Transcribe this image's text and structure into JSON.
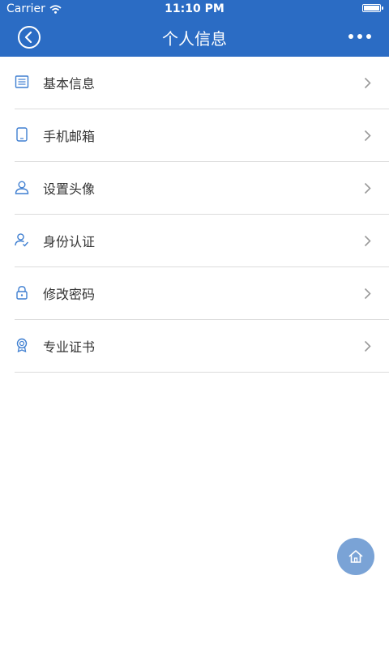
{
  "status_bar": {
    "carrier": "Carrier",
    "time": "11:10 PM"
  },
  "header": {
    "title": "个人信息"
  },
  "menu": {
    "items": [
      {
        "label": "基本信息",
        "icon": "document-list-icon"
      },
      {
        "label": "手机邮箱",
        "icon": "tablet-icon"
      },
      {
        "label": "设置头像",
        "icon": "user-icon"
      },
      {
        "label": "身份认证",
        "icon": "user-verified-icon"
      },
      {
        "label": "修改密码",
        "icon": "lock-icon"
      },
      {
        "label": "专业证书",
        "icon": "certificate-icon"
      }
    ]
  },
  "colors": {
    "accent": "#2b6cc4",
    "fab": "#7aa3d6",
    "divider": "#dcdcdc"
  }
}
